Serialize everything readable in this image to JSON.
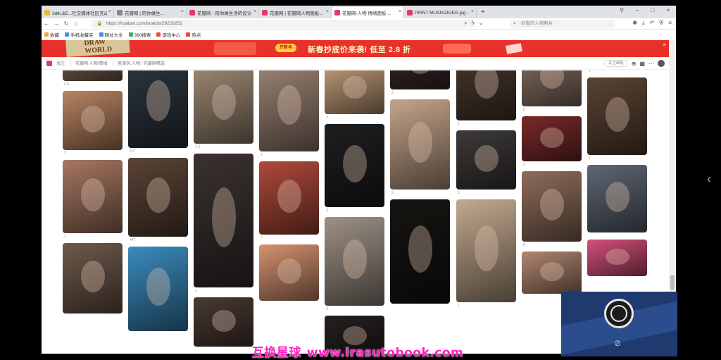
{
  "browser": {
    "tabs": [
      {
        "label": "3dtk,&E...社交媒体社区互动",
        "fav": "#e6b93a"
      },
      {
        "label": "花瓣网 | 陪你做生...",
        "fav": "#888"
      },
      {
        "label": "花瓣网 - 陪你做生活的设计...",
        "fav": "#e3396b"
      },
      {
        "label": "花瓣网 | 花瓣网人物画板...",
        "fav": "#e3396b"
      },
      {
        "label": "花瓣网-人物 情绪面板 ...",
        "fav": "#e3396b",
        "active": true
      },
      {
        "label": "PRINT MUSIKZIGEG.jpg ...",
        "fav": "#e3396b"
      }
    ],
    "new_tab": "+",
    "window_controls": [
      "⚲",
      "–",
      "□",
      "×"
    ],
    "address": {
      "url": "https://huaban.com/boards/29226251",
      "lock": "🔒"
    },
    "search": {
      "placeholder": "好看的人物照片"
    },
    "bookmarks": [
      {
        "label": "收藏",
        "color": "#f2a33a"
      },
      {
        "label": "手机收藏夹",
        "color": "#4a90e2"
      },
      {
        "label": "网址大全",
        "color": "#4a90e2"
      },
      {
        "label": "360搜索",
        "color": "#3ab15a"
      },
      {
        "label": "游戏中心",
        "color": "#e94b3c"
      },
      {
        "label": "热点",
        "color": "#e94b3c"
      }
    ]
  },
  "page": {
    "banner": {
      "logo": "DRAW WORLD",
      "button": "开新年",
      "text": "新春抄底价来袭! 低至 2.8 折",
      "close": "×"
    },
    "subnav": {
      "label": "关注",
      "crumb1": "花瓣网 人物/情绪",
      "crumb2": "欧美风 人物 / 花瓣网精选",
      "follow": "关注画板",
      "more_icon": "⋯"
    }
  },
  "pins": [
    {
      "col": 0,
      "color": "#7a6352",
      "h": 55,
      "meta": "4  6"
    },
    {
      "col": 0,
      "color": "#b98563",
      "h": 84,
      "meta": "2"
    },
    {
      "col": 0,
      "color": "#a77862",
      "h": 104,
      "meta": "1"
    },
    {
      "col": 0,
      "color": "#6f5a4c",
      "h": 100,
      "meta": ""
    },
    {
      "col": 1,
      "color": "#2d3740",
      "h": 128,
      "meta": "3  4"
    },
    {
      "col": 1,
      "color": "#5b4437",
      "h": 112,
      "meta": "447"
    },
    {
      "col": 1,
      "color": "#3b8bbd",
      "h": 120,
      "meta": ""
    },
    {
      "col": 2,
      "color": "#9f8a76",
      "h": 112,
      "meta": "1  3"
    },
    {
      "col": 2,
      "color": "#3a3230",
      "h": 190,
      "meta": "1"
    },
    {
      "col": 2,
      "color": "#4a3a33",
      "h": 70,
      "meta": ""
    },
    {
      "col": 3,
      "color": "#5c4538",
      "h": 30,
      "meta": "4"
    },
    {
      "col": 3,
      "color": "#9d8576",
      "h": 126,
      "meta": "2"
    },
    {
      "col": 3,
      "color": "#b04a3a",
      "h": 104,
      "meta": "7"
    },
    {
      "col": 3,
      "color": "#d69370",
      "h": 80,
      "meta": ""
    },
    {
      "col": 4,
      "color": "#c19c79",
      "h": 72,
      "meta": "3"
    },
    {
      "col": 4,
      "color": "#1f1f22",
      "h": 118,
      "meta": "3"
    },
    {
      "col": 4,
      "color": "#9e9186",
      "h": 126,
      "meta": "3"
    },
    {
      "col": 4,
      "color": "#25211f",
      "h": 60,
      "meta": ""
    },
    {
      "col": 5,
      "color": "#3a2c28",
      "h": 72,
      "meta": "2"
    },
    {
      "col": 5,
      "color": "#c4a58b",
      "h": 128,
      "meta": "2"
    },
    {
      "col": 5,
      "color": "#171512",
      "h": 148,
      "meta": ""
    },
    {
      "col": 6,
      "color": "#6b5545",
      "h": 2,
      "meta": ""
    },
    {
      "col": 6,
      "color": "#4b3a30",
      "h": 104,
      "meta": "1"
    },
    {
      "col": 6,
      "color": "#3e3a3a",
      "h": 84,
      "meta": "1"
    },
    {
      "col": 6,
      "color": "#c3a98f",
      "h": 146,
      "meta": "1"
    },
    {
      "col": 7,
      "color": "#2b2524",
      "h": 2,
      "meta": ""
    },
    {
      "col": 7,
      "color": "#8a7466",
      "h": 84,
      "meta": "8"
    },
    {
      "col": 7,
      "color": "#7a2a2a",
      "h": 64,
      "meta": "2"
    },
    {
      "col": 7,
      "color": "#8f6e5a",
      "h": 100,
      "meta": "6"
    },
    {
      "col": 7,
      "color": "#b08770",
      "h": 60,
      "meta": ""
    },
    {
      "col": 8,
      "color": "#2a2222",
      "h": 16,
      "meta": "1"
    },
    {
      "col": 8,
      "color": "#5a4434",
      "h": 110,
      "meta": "1"
    },
    {
      "col": 8,
      "color": "#5f6776",
      "h": 96,
      "meta": ""
    },
    {
      "col": 8,
      "color": "#d4507a",
      "h": 52,
      "meta": ""
    }
  ],
  "overlay": {
    "watermark_cn": "互换星球",
    "watermark_url": "www.irasutobook.com",
    "obs_icon": "obs-logo"
  },
  "side_arrow": "‹"
}
